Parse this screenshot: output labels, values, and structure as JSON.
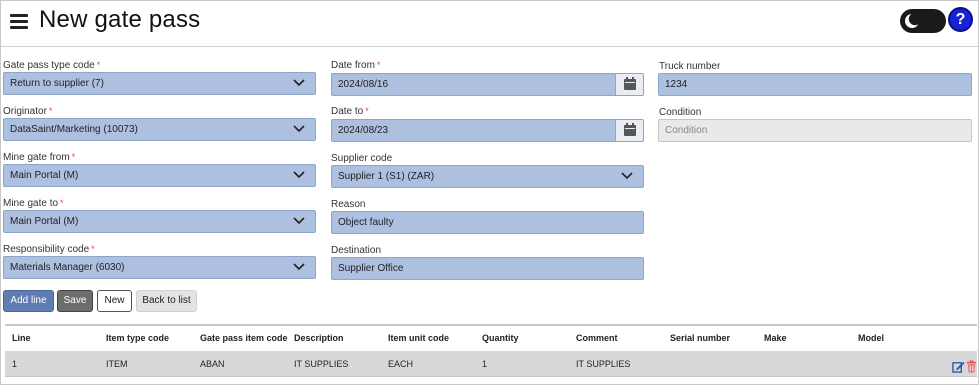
{
  "header": {
    "title": "New gate pass",
    "menu_icon": "hamburger-menu-icon",
    "theme_toggle_icon": "moon-icon",
    "help_label": "?"
  },
  "form": {
    "gate_pass_type": {
      "label": "Gate pass type code",
      "required": "*",
      "value": "Return to supplier (7)"
    },
    "originator": {
      "label": "Originator",
      "required": "*",
      "value": "DataSaint/Marketing (10073)"
    },
    "mine_gate_from": {
      "label": "Mine gate from",
      "required": "*",
      "value": "Main Portal (M)"
    },
    "mine_gate_to": {
      "label": "Mine gate to",
      "required": "*",
      "value": "Main Portal (M)"
    },
    "responsibility_code": {
      "label": "Responsibility code",
      "required": "*",
      "value": "Materials Manager (6030)"
    },
    "date_from": {
      "label": "Date from",
      "required": "*",
      "value": "2024/08/16"
    },
    "date_to": {
      "label": "Date to",
      "required": "*",
      "value": "2024/08/23"
    },
    "supplier_code": {
      "label": "Supplier code",
      "value": "Supplier 1 (S1) (ZAR)"
    },
    "reason": {
      "label": "Reason",
      "value": "Object faulty"
    },
    "destination": {
      "label": "Destination",
      "value": "Supplier Office"
    },
    "truck_number": {
      "label": "Truck number",
      "value": "1234"
    },
    "condition": {
      "label": "Condition",
      "placeholder": "Condition"
    }
  },
  "buttons": {
    "add_line": "Add line",
    "save": "Save",
    "new": "New",
    "back": "Back to list"
  },
  "table": {
    "columns": [
      "Line",
      "Item type code",
      "Gate pass item code",
      "Description",
      "Item unit code",
      "Quantity",
      "Comment",
      "Serial number",
      "Make",
      "Model"
    ],
    "rows": [
      {
        "cells": [
          "1",
          "ITEM",
          "ABAN",
          "IT SUPPLIES",
          "EACH",
          "1",
          "IT SUPPLIES",
          "",
          "",
          ""
        ],
        "edit_icon": "edit-icon",
        "delete_icon": "trash-icon"
      }
    ]
  },
  "colors": {
    "field_bg": "#adc0e0",
    "required": "#e04a3a",
    "help_blue": "#1a22d6",
    "delete_red": "#e05050",
    "edit_blue": "#2a5ea8"
  }
}
